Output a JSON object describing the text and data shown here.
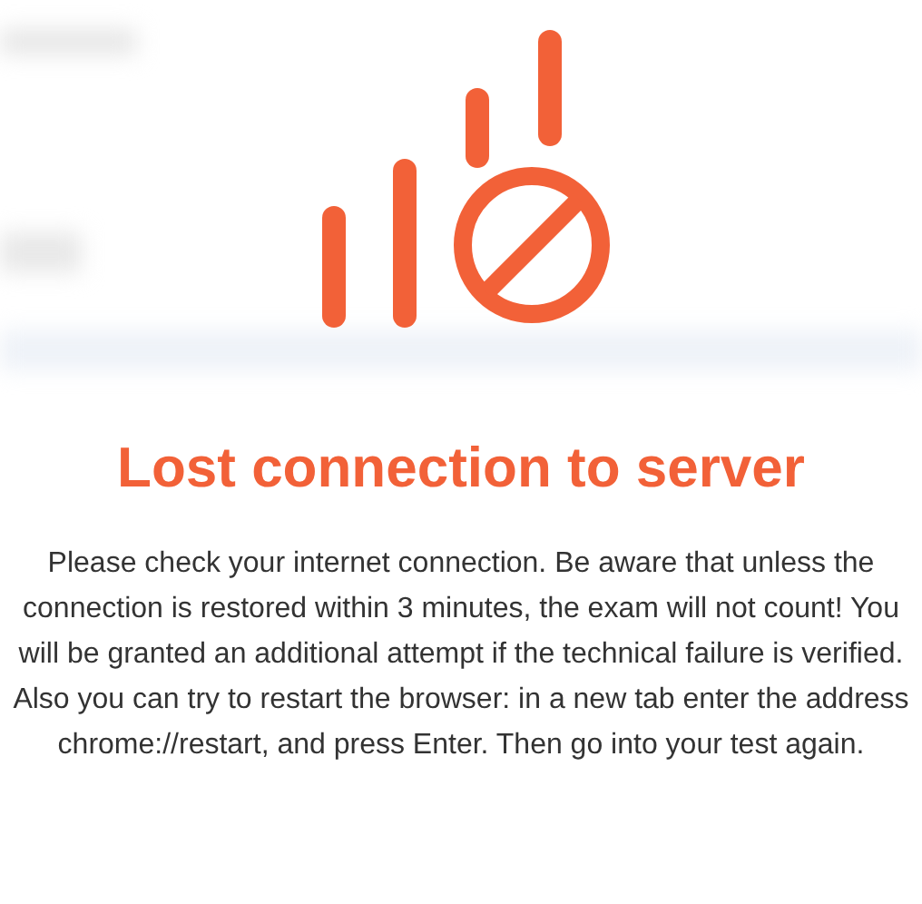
{
  "dialog": {
    "title": "Lost connection to server",
    "message": "Please check your internet connection. Be aware that unless the connection is restored within 3 minutes, the exam will not count! You will be granted an additional attempt if the technical failure is verified. Also you can try to restart the browser: in a new tab enter the address chrome://restart, and press Enter. Then go into your test again."
  }
}
